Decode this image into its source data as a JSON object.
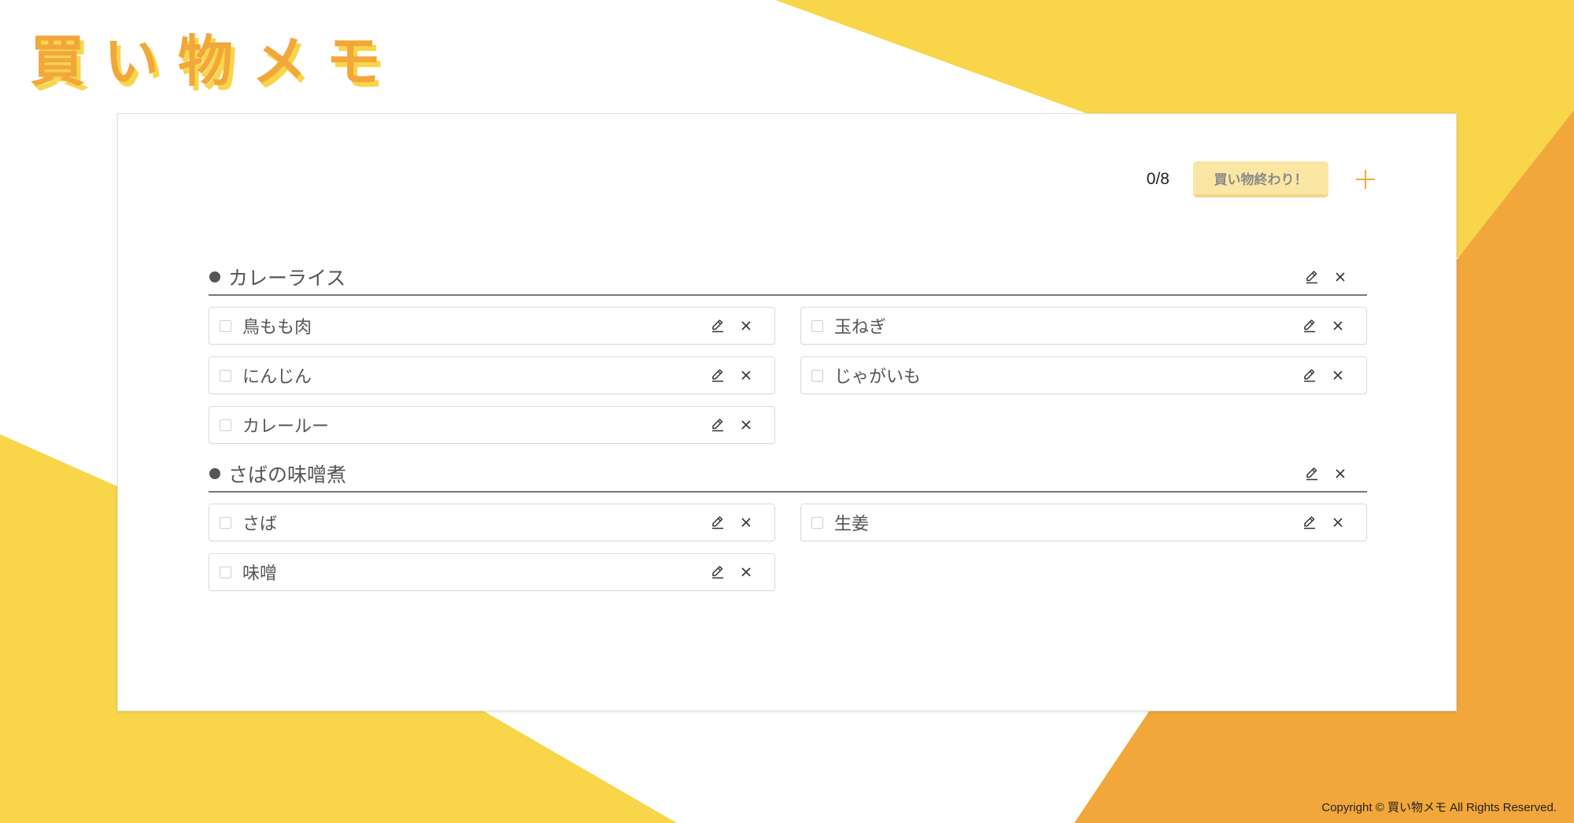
{
  "app": {
    "logo_text": "買い物メモ"
  },
  "colors": {
    "yellow": "#f9d54a",
    "orange": "#f2a73b",
    "button_bg": "#fbe7a4"
  },
  "toolbar": {
    "counter": "0/8",
    "done_label": "買い物終わり！",
    "add_icon": "plus-icon"
  },
  "sections": [
    {
      "title": "カレーライス",
      "items": [
        {
          "label": "鳥もも肉",
          "checked": false
        },
        {
          "label": "玉ねぎ",
          "checked": false
        },
        {
          "label": "にんじん",
          "checked": false
        },
        {
          "label": "じゃがいも",
          "checked": false
        },
        {
          "label": "カレールー",
          "checked": false
        }
      ]
    },
    {
      "title": "さばの味噌煮",
      "items": [
        {
          "label": "さば",
          "checked": false
        },
        {
          "label": "生姜",
          "checked": false
        },
        {
          "label": "味噌",
          "checked": false
        }
      ]
    }
  ],
  "icons": {
    "edit": "pencil-icon",
    "delete": "close-icon"
  },
  "footer": {
    "copyright": "Copyright © 買い物メモ All Rights Reserved."
  }
}
